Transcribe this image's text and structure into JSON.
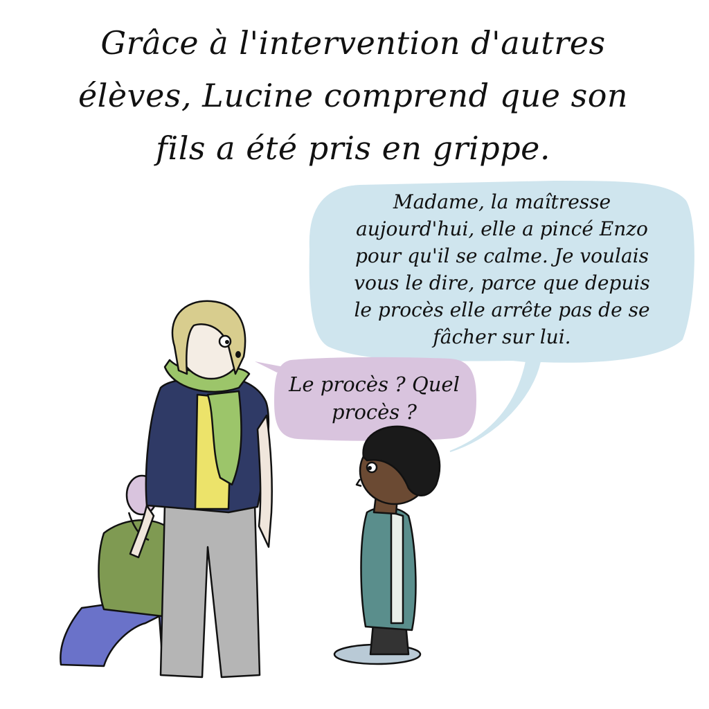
{
  "caption": "Grâce à l'intervention d'autres\nélèves, Lucine comprend que son\nfils a été pris en grippe.",
  "boy_bubble": {
    "text": "Madame, la maîtresse\naujourd'hui, elle a pincé Enzo\npour qu'il se calme. Je voulais\nvous le dire, parce que depuis\nle procès elle arrête pas de se\nfâcher sur lui.",
    "color": "#cfe5ee"
  },
  "mom_bubble": {
    "text": "Le procès ? Quel\nprocès ?",
    "color": "#d9c4de"
  },
  "colors": {
    "hair_mom": "#d8cd8e",
    "scarf": "#9cc56a",
    "jacket": "#2f3a66",
    "top": "#ece36a",
    "pants": "#b5b5b5",
    "child_sweater": "#7f9a52",
    "child_pants": "#6a72c9",
    "boy_skin": "#6b4a33",
    "boy_jacket": "#5a8e8c",
    "ink": "#111111"
  }
}
